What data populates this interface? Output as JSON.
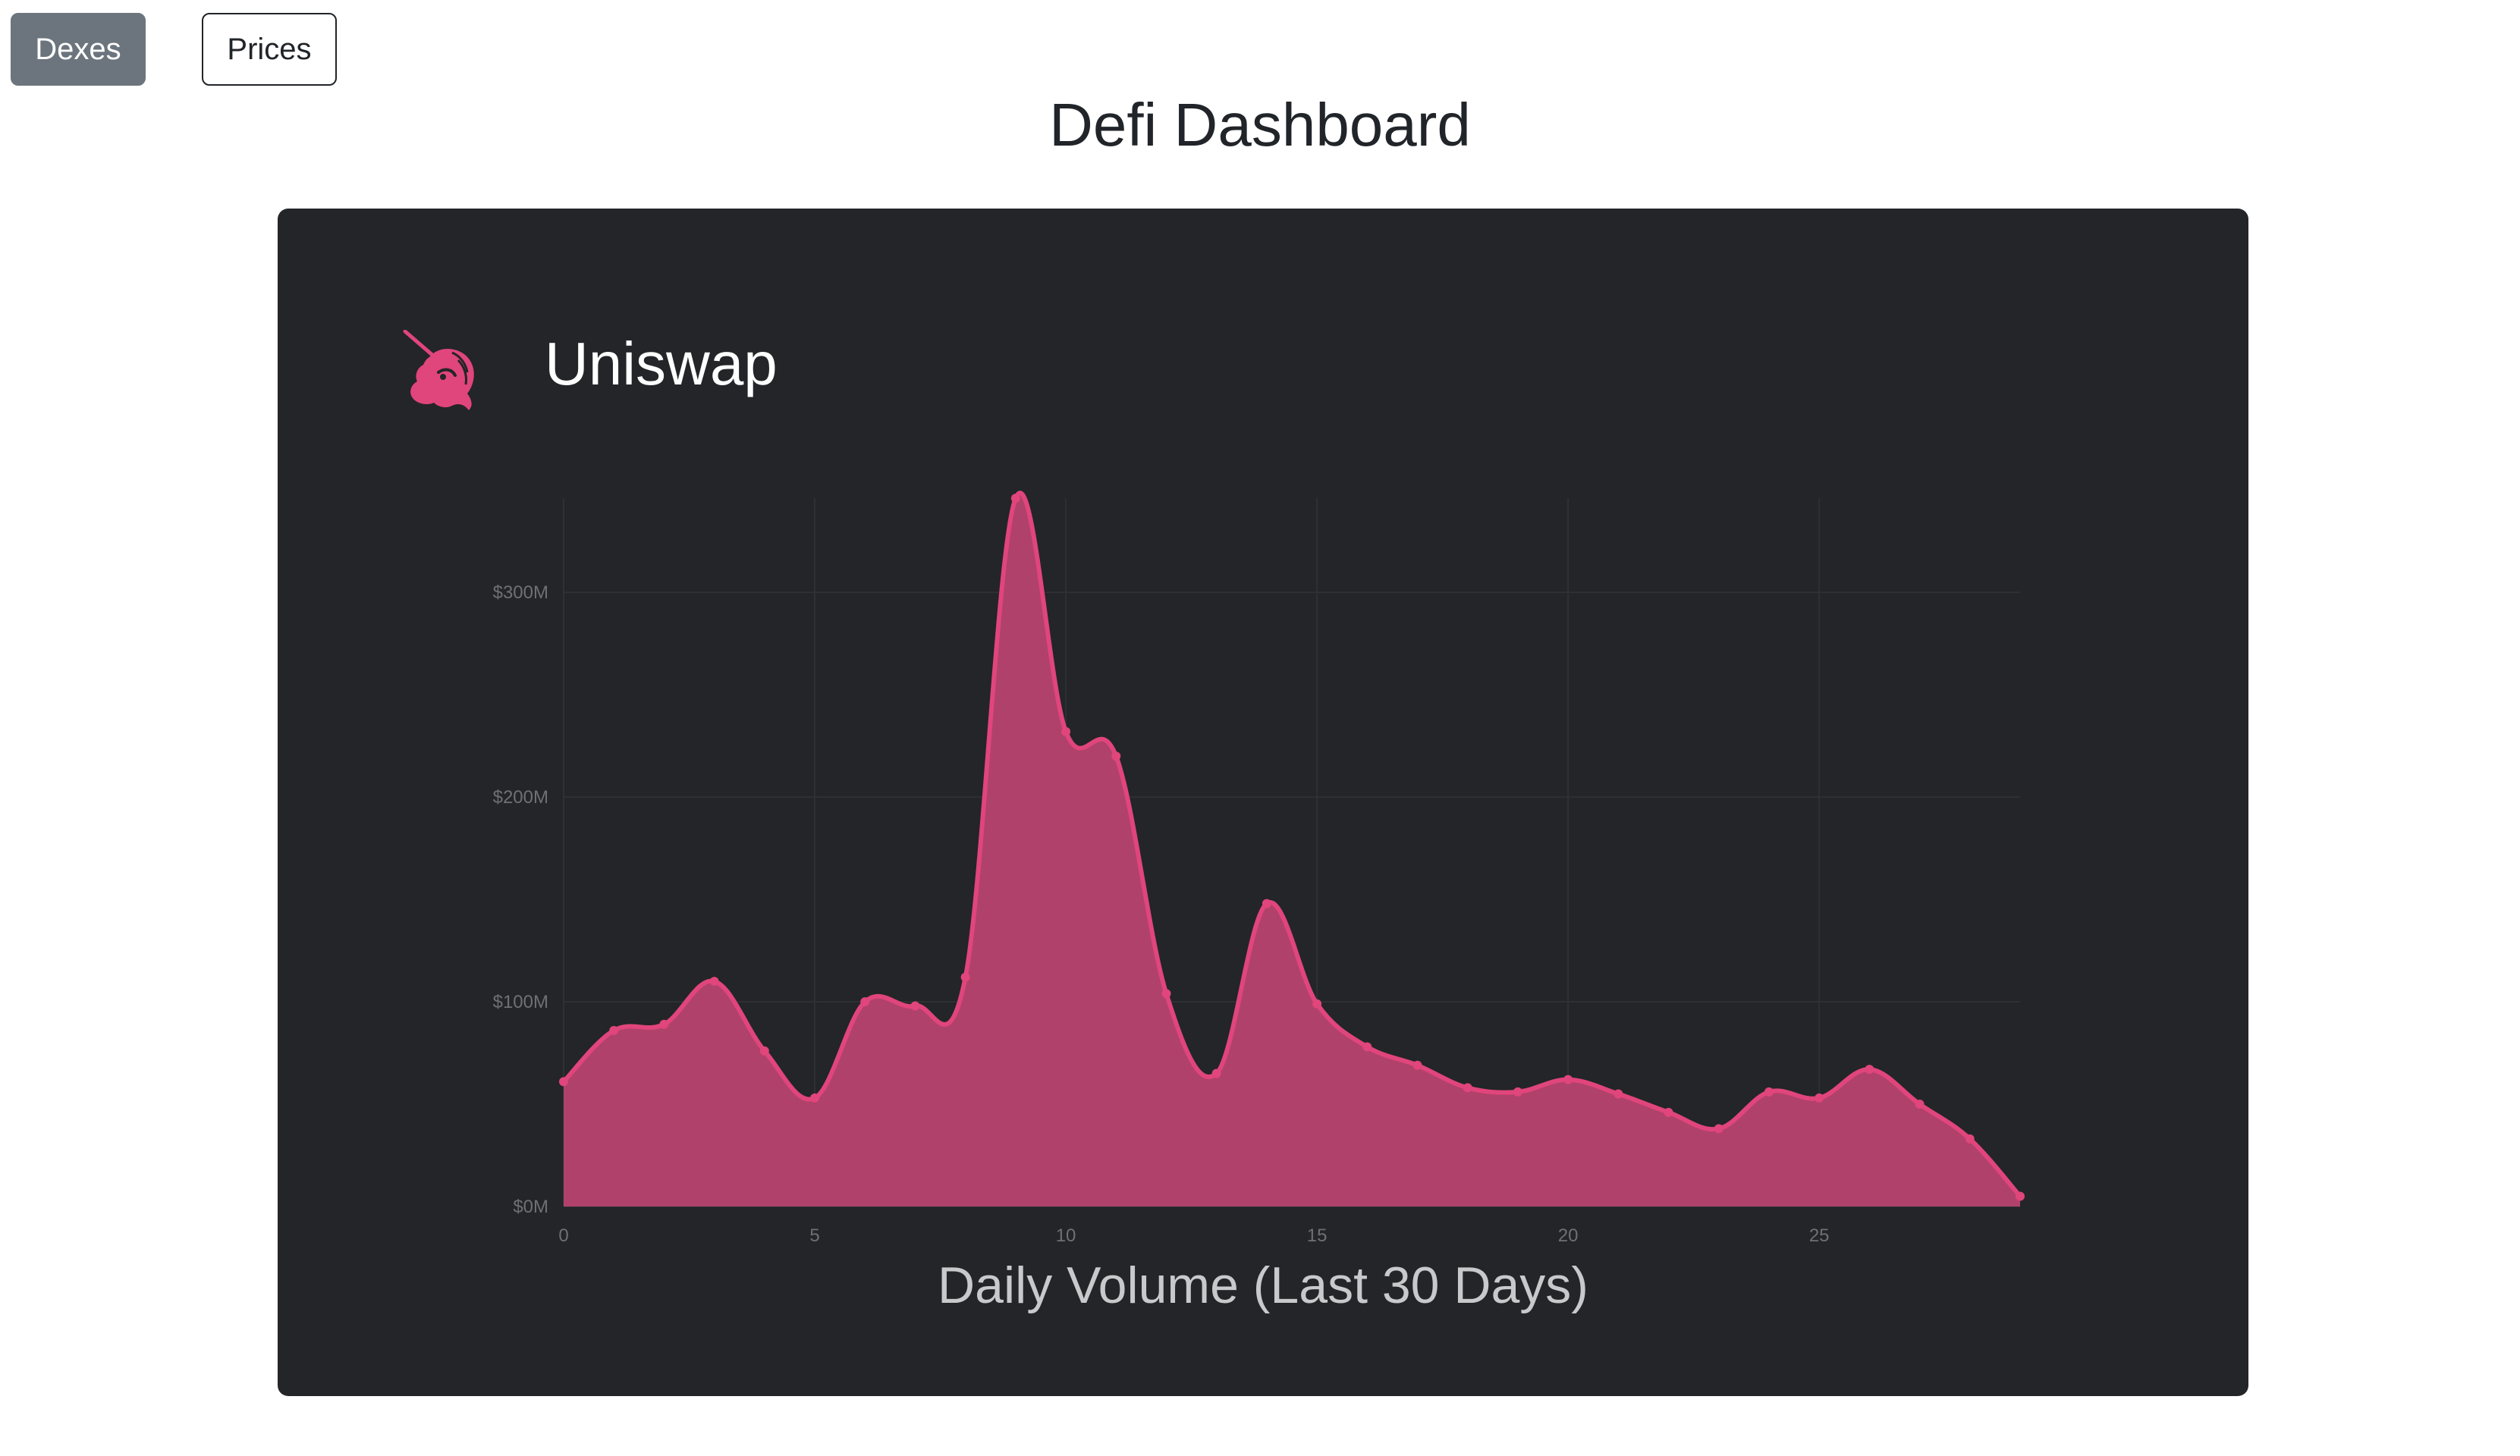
{
  "nav": {
    "dexes_label": "Dexes",
    "prices_label": "Prices"
  },
  "page_title": "Defi Dashboard",
  "card": {
    "dex_name": "Uniswap",
    "logo_icon": "unicorn-icon"
  },
  "colors": {
    "card_bg": "#232528",
    "series_line": "#e0457b",
    "series_fill": "#b0416a",
    "grid": "#2e3033",
    "tick_text": "#6e7074"
  },
  "chart_data": {
    "type": "area",
    "title": "",
    "xlabel": "Daily Volume (Last 30 Days)",
    "ylabel": "",
    "x": [
      0,
      1,
      2,
      3,
      4,
      5,
      6,
      7,
      8,
      9,
      10,
      11,
      12,
      13,
      14,
      15,
      16,
      17,
      18,
      19,
      20,
      21,
      22,
      23,
      24,
      25,
      26,
      27,
      28,
      29
    ],
    "y": [
      61,
      86,
      89,
      110,
      76,
      53,
      100,
      98,
      112,
      346,
      232,
      220,
      104,
      65,
      148,
      99,
      78,
      69,
      58,
      56,
      62,
      55,
      46,
      38,
      56,
      53,
      67,
      50,
      33,
      5
    ],
    "xlim": [
      0,
      29
    ],
    "ylim": [
      0,
      346
    ],
    "x_ticks": [
      0,
      5,
      10,
      15,
      20,
      25
    ],
    "y_ticks": [
      0,
      100,
      200,
      300
    ],
    "y_tick_labels": [
      "$0M",
      "$100M",
      "$200M",
      "$300M"
    ],
    "y_unit": "millions USD",
    "grid": true,
    "legend": "none",
    "curve": "smooth"
  }
}
